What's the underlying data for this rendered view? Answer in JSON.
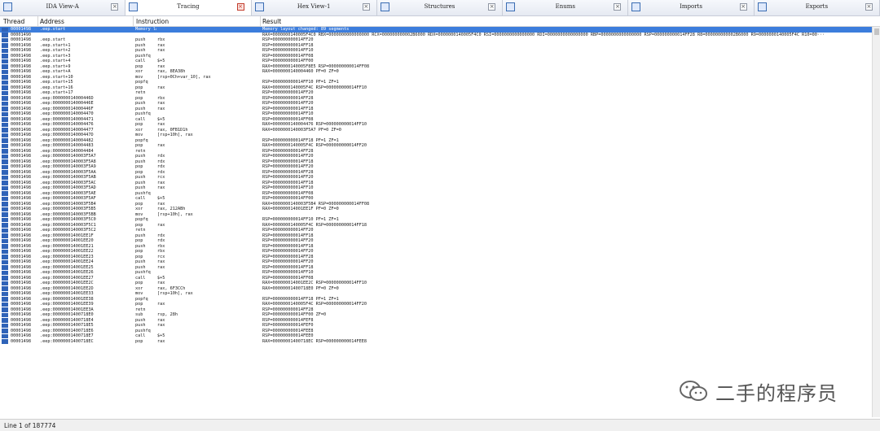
{
  "tabs": [
    {
      "label": "IDA View-A",
      "icon": "ida-view-icon",
      "active": false
    },
    {
      "label": "Tracing",
      "icon": "tracing-icon",
      "active": true
    },
    {
      "label": "Hex View-1",
      "icon": "hex-view-icon",
      "active": false
    },
    {
      "label": "Structures",
      "icon": "structures-icon",
      "active": false
    },
    {
      "label": "Enums",
      "icon": "enums-icon",
      "active": false
    },
    {
      "label": "Imports",
      "icon": "imports-icon",
      "active": false
    },
    {
      "label": "Exports",
      "icon": "exports-icon",
      "active": false
    }
  ],
  "columns": {
    "thread": "Thread",
    "address": "Address",
    "instruction": "Instruction",
    "result": "Result"
  },
  "rows": [
    [
      "00001498",
      ".eep.start",
      "Memory layout changed: 89 segments",
      "",
      "Memory layout changed: 89 segments"
    ],
    [
      "00001490",
      "",
      "",
      "",
      "RAX=0000000140005F4C0 RBX=0000000000000000 RCX=000000000002B6000 RDX=0000000140005F4C0 RSI=0000000000000000 RDI=0000000000000000 RBP=0000000000000000 RSP=000000000014FF28 R8=000000000002B6000 R9=0000000140005F4C R10=00···"
    ],
    [
      "00001498",
      ".eep.start",
      "push",
      "rbx",
      "RSP=000000000014FF20"
    ],
    [
      "00001498",
      ".eep.start+1",
      "push",
      "rax",
      "RSP=000000000014FF18"
    ],
    [
      "00001498",
      ".eep.start+2",
      "push",
      "rax",
      "RSP=000000000014FF10"
    ],
    [
      "00001498",
      ".eep.start+3",
      "pushfq",
      "",
      "RSP=000000000014FF08"
    ],
    [
      "00001498",
      ".eep.start+4",
      "call",
      "$+5",
      "RSP=000000000014FF00"
    ],
    [
      "00001498",
      ".eep.start+9",
      "pop",
      "rax",
      "RAX=0000000140005F8E5 RSP=000000000014FF08"
    ],
    [
      "00001498",
      ".eep.start+A",
      "xor",
      "rax, 8EA38h",
      "RAX=0000000140004460 PF=0 ZF=0"
    ],
    [
      "00001498",
      ".eep.start+10",
      "mov",
      "[rsp+0Ch+var_10], rax",
      ""
    ],
    [
      "00001498",
      ".eep.start+15",
      "popfq",
      "",
      "RSP=000000000014FF10 PF=1 ZF=1"
    ],
    [
      "00001498",
      ".eep.start+16",
      "pop",
      "rax",
      "RAX=0000000140005F4C RSP=000000000014FF10"
    ],
    [
      "00001498",
      ".eep.start+17",
      "retn",
      "",
      "RSP=000000000014FF20"
    ],
    [
      "00001498",
      ".eep:000000014000446D",
      "pop",
      "rbx",
      "RSP=000000000014FF28"
    ],
    [
      "00001498",
      ".eep:000000014000446E",
      "push",
      "rax",
      "RSP=000000000014FF20"
    ],
    [
      "00001498",
      ".eep:000000014000446F",
      "push",
      "rax",
      "RSP=000000000014FF18"
    ],
    [
      "00001498",
      ".eep:0000000140004470",
      "pushfq",
      "",
      "RSP=000000000014FF10"
    ],
    [
      "00001498",
      ".eep:0000000140004471",
      "call",
      "$+5",
      "RSP=000000000014FF08"
    ],
    [
      "00001498",
      ".eep:0000000140004476",
      "pop",
      "rax",
      "RAX=0000000140004476 RSP=000000000014FF10"
    ],
    [
      "00001498",
      ".eep:0000000140004477",
      "xor",
      "rax, 0FB1D1h",
      "RAX=0000000140003F5A7 PF=0 ZF=0"
    ],
    [
      "00001498",
      ".eep:000000014000447D",
      "mov",
      "[rsp+10h], rax",
      ""
    ],
    [
      "00001498",
      ".eep:0000000140004482",
      "popfq",
      "",
      "RSP=000000000014FF18 PF=1 ZF=1"
    ],
    [
      "00001498",
      ".eep:0000000140004483",
      "pop",
      "rax",
      "RAX=0000000140005F4C RSP=000000000014FF20"
    ],
    [
      "00001498",
      ".eep:0000000140004484",
      "retn",
      "",
      "RSP=000000000014FF28"
    ],
    [
      "00001498",
      ".eep:0000000140003F5A7",
      "push",
      "rdx",
      "RSP=000000000014FF20"
    ],
    [
      "00001498",
      ".eep:0000000140003F5A8",
      "push",
      "rdx",
      "RSP=000000000014FF18"
    ],
    [
      "00001498",
      ".eep:0000000140003F5A9",
      "pop",
      "rdx",
      "RSP=000000000014FF20"
    ],
    [
      "00001498",
      ".eep:0000000140003F5AA",
      "pop",
      "rdx",
      "RSP=000000000014FF28"
    ],
    [
      "00001498",
      ".eep:0000000140003F5AB",
      "push",
      "rcx",
      "RSP=000000000014FF20"
    ],
    [
      "00001498",
      ".eep:0000000140003F5AC",
      "push",
      "rax",
      "RSP=000000000014FF18"
    ],
    [
      "00001498",
      ".eep:0000000140003F5AD",
      "push",
      "rax",
      "RSP=000000000014FF10"
    ],
    [
      "00001498",
      ".eep:0000000140003F5AE",
      "pushfq",
      "",
      "RSP=000000000014FF08"
    ],
    [
      "00001498",
      ".eep:0000000140003F5AF",
      "call",
      "$+5",
      "RSP=000000000014FF00"
    ],
    [
      "00001498",
      ".eep:0000000140003F5B4",
      "pop",
      "rax",
      "RAX=0000000140003F5B4 RSP=000000000014FF08"
    ],
    [
      "00001498",
      ".eep:0000000140003F5B5",
      "xor",
      "rax, 212ABh",
      "RAX=000000014001EE1F PF=0 ZF=0"
    ],
    [
      "00001498",
      ".eep:0000000140003F5BB",
      "mov",
      "[rsp+10h], rax",
      ""
    ],
    [
      "00001498",
      ".eep:0000000140003F5C0",
      "popfq",
      "",
      "RSP=000000000014FF10 PF=1 ZF=1"
    ],
    [
      "00001498",
      ".eep:0000000140003F5C1",
      "pop",
      "rax",
      "RAX=0000000140005F4C RSP=000000000014FF18"
    ],
    [
      "00001498",
      ".eep:0000000140003F5C2",
      "retn",
      "",
      "RSP=000000000014FF20"
    ],
    [
      "00001498",
      ".eep:000000014001EE1F",
      "push",
      "rdx",
      "RSP=000000000014FF18"
    ],
    [
      "00001498",
      ".eep:000000014001EE20",
      "pop",
      "rdx",
      "RSP=000000000014FF20"
    ],
    [
      "00001498",
      ".eep:000000014001EE21",
      "push",
      "rbx",
      "RSP=000000000014FF18"
    ],
    [
      "00001498",
      ".eep:000000014001EE22",
      "pop",
      "rbx",
      "RSP=000000000014FF20"
    ],
    [
      "00001498",
      ".eep:000000014001EE23",
      "pop",
      "rcx",
      "RSP=000000000014FF28"
    ],
    [
      "00001498",
      ".eep:000000014001EE24",
      "push",
      "rax",
      "RSP=000000000014FF20"
    ],
    [
      "00001498",
      ".eep:000000014001EE25",
      "push",
      "rax",
      "RSP=000000000014FF18"
    ],
    [
      "00001498",
      ".eep:000000014001EE26",
      "pushfq",
      "",
      "RSP=000000000014FF10"
    ],
    [
      "00001498",
      ".eep:000000014001EE27",
      "call",
      "$+5",
      "RSP=000000000014FF08"
    ],
    [
      "00001498",
      ".eep:000000014001EE2C",
      "pop",
      "rax",
      "RAX=000000014001EE2C RSP=000000000014FF10"
    ],
    [
      "00001498",
      ".eep:000000014001EE2D",
      "xor",
      "rax, 6F3CCh",
      "RAX=00000001400718E0 PF=0 ZF=0"
    ],
    [
      "00001498",
      ".eep:000000014001EE33",
      "mov",
      "[rsp+10h], rax",
      ""
    ],
    [
      "00001498",
      ".eep:000000014001EE38",
      "popfq",
      "",
      "RSP=000000000014FF18 PF=1 ZF=1"
    ],
    [
      "00001498",
      ".eep:000000014001EE39",
      "pop",
      "rax",
      "RAX=0000000140005F4C RSP=000000000014FF20"
    ],
    [
      "00001498",
      ".eep:000000014001EE3A",
      "retn",
      "",
      "RSP=000000000014FF28"
    ],
    [
      "00001498",
      ".eep:00000001400718E0",
      "sub",
      "rsp, 28h",
      "RSP=000000000014FF00 ZF=0"
    ],
    [
      "00001498",
      ".eep:00000001400718E4",
      "push",
      "rax",
      "RSP=000000000014FEF8"
    ],
    [
      "00001498",
      ".eep:00000001400718E5",
      "push",
      "rax",
      "RSP=000000000014FEF0"
    ],
    [
      "00001498",
      ".eep:00000001400718E6",
      "pushfq",
      "",
      "RSP=000000000014FEE8"
    ],
    [
      "00001498",
      ".eep:00000001400718E7",
      "call",
      "$+5",
      "RSP=000000000014FEE0"
    ],
    [
      "00001498",
      ".eep:00000001400718EC",
      "pop",
      "rax",
      "RAX=00000001400718EC RSP=000000000014FEE8"
    ]
  ],
  "status": {
    "line": "Line 1 of 187774"
  },
  "watermark": {
    "text": "二手的程序员",
    "icon": "wechat-logo-icon"
  }
}
